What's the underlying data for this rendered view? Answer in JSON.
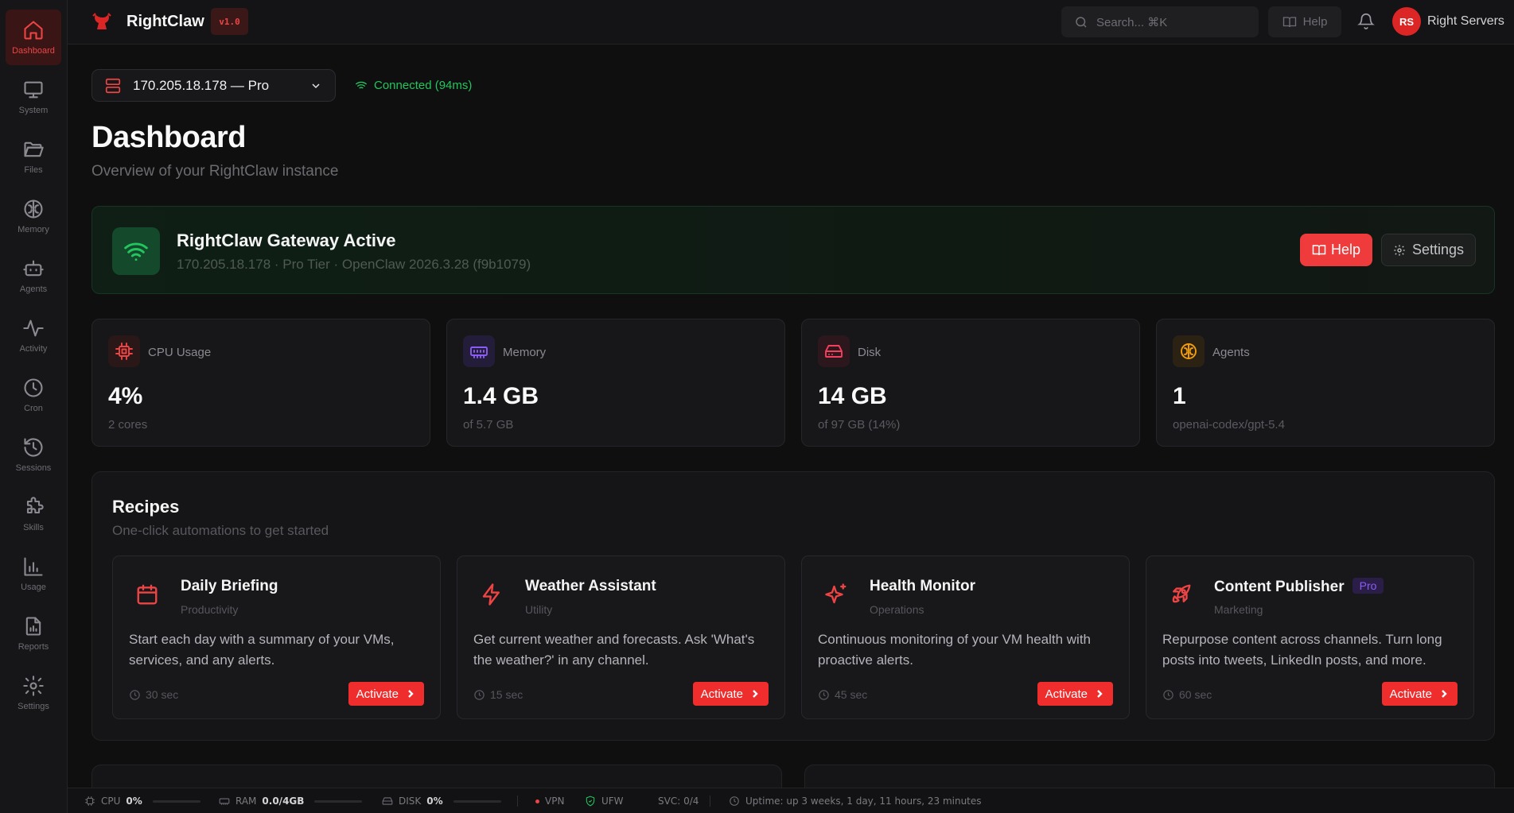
{
  "sidebar": {
    "items": [
      {
        "label": "Dashboard",
        "icon": "home-icon"
      },
      {
        "label": "System",
        "icon": "monitor-icon"
      },
      {
        "label": "Files",
        "icon": "folder-icon"
      },
      {
        "label": "Memory",
        "icon": "brain-icon"
      },
      {
        "label": "Agents",
        "icon": "bot-icon"
      },
      {
        "label": "Activity",
        "icon": "activity-icon"
      },
      {
        "label": "Cron",
        "icon": "clock-icon"
      },
      {
        "label": "Sessions",
        "icon": "history-icon"
      },
      {
        "label": "Skills",
        "icon": "puzzle-icon"
      },
      {
        "label": "Usage",
        "icon": "bar-chart-icon"
      },
      {
        "label": "Reports",
        "icon": "report-icon"
      },
      {
        "label": "Settings",
        "icon": "gear-icon"
      }
    ],
    "active": "Dashboard"
  },
  "topbar": {
    "brand": "RightClaw",
    "version": "v1.0",
    "search_placeholder": "Search... ⌘K",
    "help_label": "Help",
    "avatar_initials": "RS",
    "user_name": "Right Servers"
  },
  "server": {
    "selected": "170.205.18.178 — Pro",
    "connection": "Connected (94ms)"
  },
  "page": {
    "title": "Dashboard",
    "subtitle": "Overview of your RightClaw instance"
  },
  "gateway": {
    "title": "RightClaw Gateway Active",
    "subtitle": "170.205.18.178 · Pro Tier · OpenClaw 2026.3.28 (f9b1079)",
    "help_label": "Help",
    "settings_label": "Settings"
  },
  "stats": [
    {
      "label": "CPU Usage",
      "value": "4%",
      "sub": "2 cores",
      "icon": "cpu-icon",
      "color": "#ef4444",
      "bg": "#2a1717"
    },
    {
      "label": "Memory",
      "value": "1.4 GB",
      "sub": "of 5.7 GB",
      "icon": "memory-icon",
      "color": "#8b5cf6",
      "bg": "#231d3a"
    },
    {
      "label": "Disk",
      "value": "14 GB",
      "sub": "of 97 GB (14%)",
      "icon": "hard-drive-icon",
      "color": "#f43f5e",
      "bg": "#2b171c"
    },
    {
      "label": "Agents",
      "value": "1",
      "sub": "openai-codex/gpt-5.4",
      "icon": "brain-icon",
      "color": "#f59e0b",
      "bg": "#2b2214"
    }
  ],
  "recipes": {
    "title": "Recipes",
    "subtitle": "One-click automations to get started",
    "items": [
      {
        "title": "Daily Briefing",
        "category": "Productivity",
        "description": "Start each day with a summary of your VMs, services, and any alerts.",
        "time": "30 sec",
        "action": "Activate",
        "icon": "calendar-icon",
        "badge": ""
      },
      {
        "title": "Weather Assistant",
        "category": "Utility",
        "description": "Get current weather and forecasts. Ask 'What's the weather?' in any channel.",
        "time": "15 sec",
        "action": "Activate",
        "icon": "zap-icon",
        "badge": ""
      },
      {
        "title": "Health Monitor",
        "category": "Operations",
        "description": "Continuous monitoring of your VM health with proactive alerts.",
        "time": "45 sec",
        "action": "Activate",
        "icon": "sparkles-icon",
        "badge": ""
      },
      {
        "title": "Content Publisher",
        "category": "Marketing",
        "description": "Repurpose content across channels. Turn long posts into tweets, LinkedIn posts, and more.",
        "time": "60 sec",
        "action": "Activate",
        "icon": "rocket-icon",
        "badge": "Pro"
      }
    ]
  },
  "statusbar": {
    "cpu_label": "CPU",
    "cpu_value": "0%",
    "cpu_fraction": 0,
    "ram_label": "RAM",
    "ram_value": "0.0/4GB",
    "ram_fraction": 0,
    "disk_label": "DISK",
    "disk_value": "0%",
    "disk_fraction": 0,
    "vpn_label": "VPN",
    "ufw_label": "UFW",
    "svc": "SVC: 0/4",
    "uptime": "Uptime: up 3 weeks, 1 day, 11 hours, 23 minutes"
  }
}
